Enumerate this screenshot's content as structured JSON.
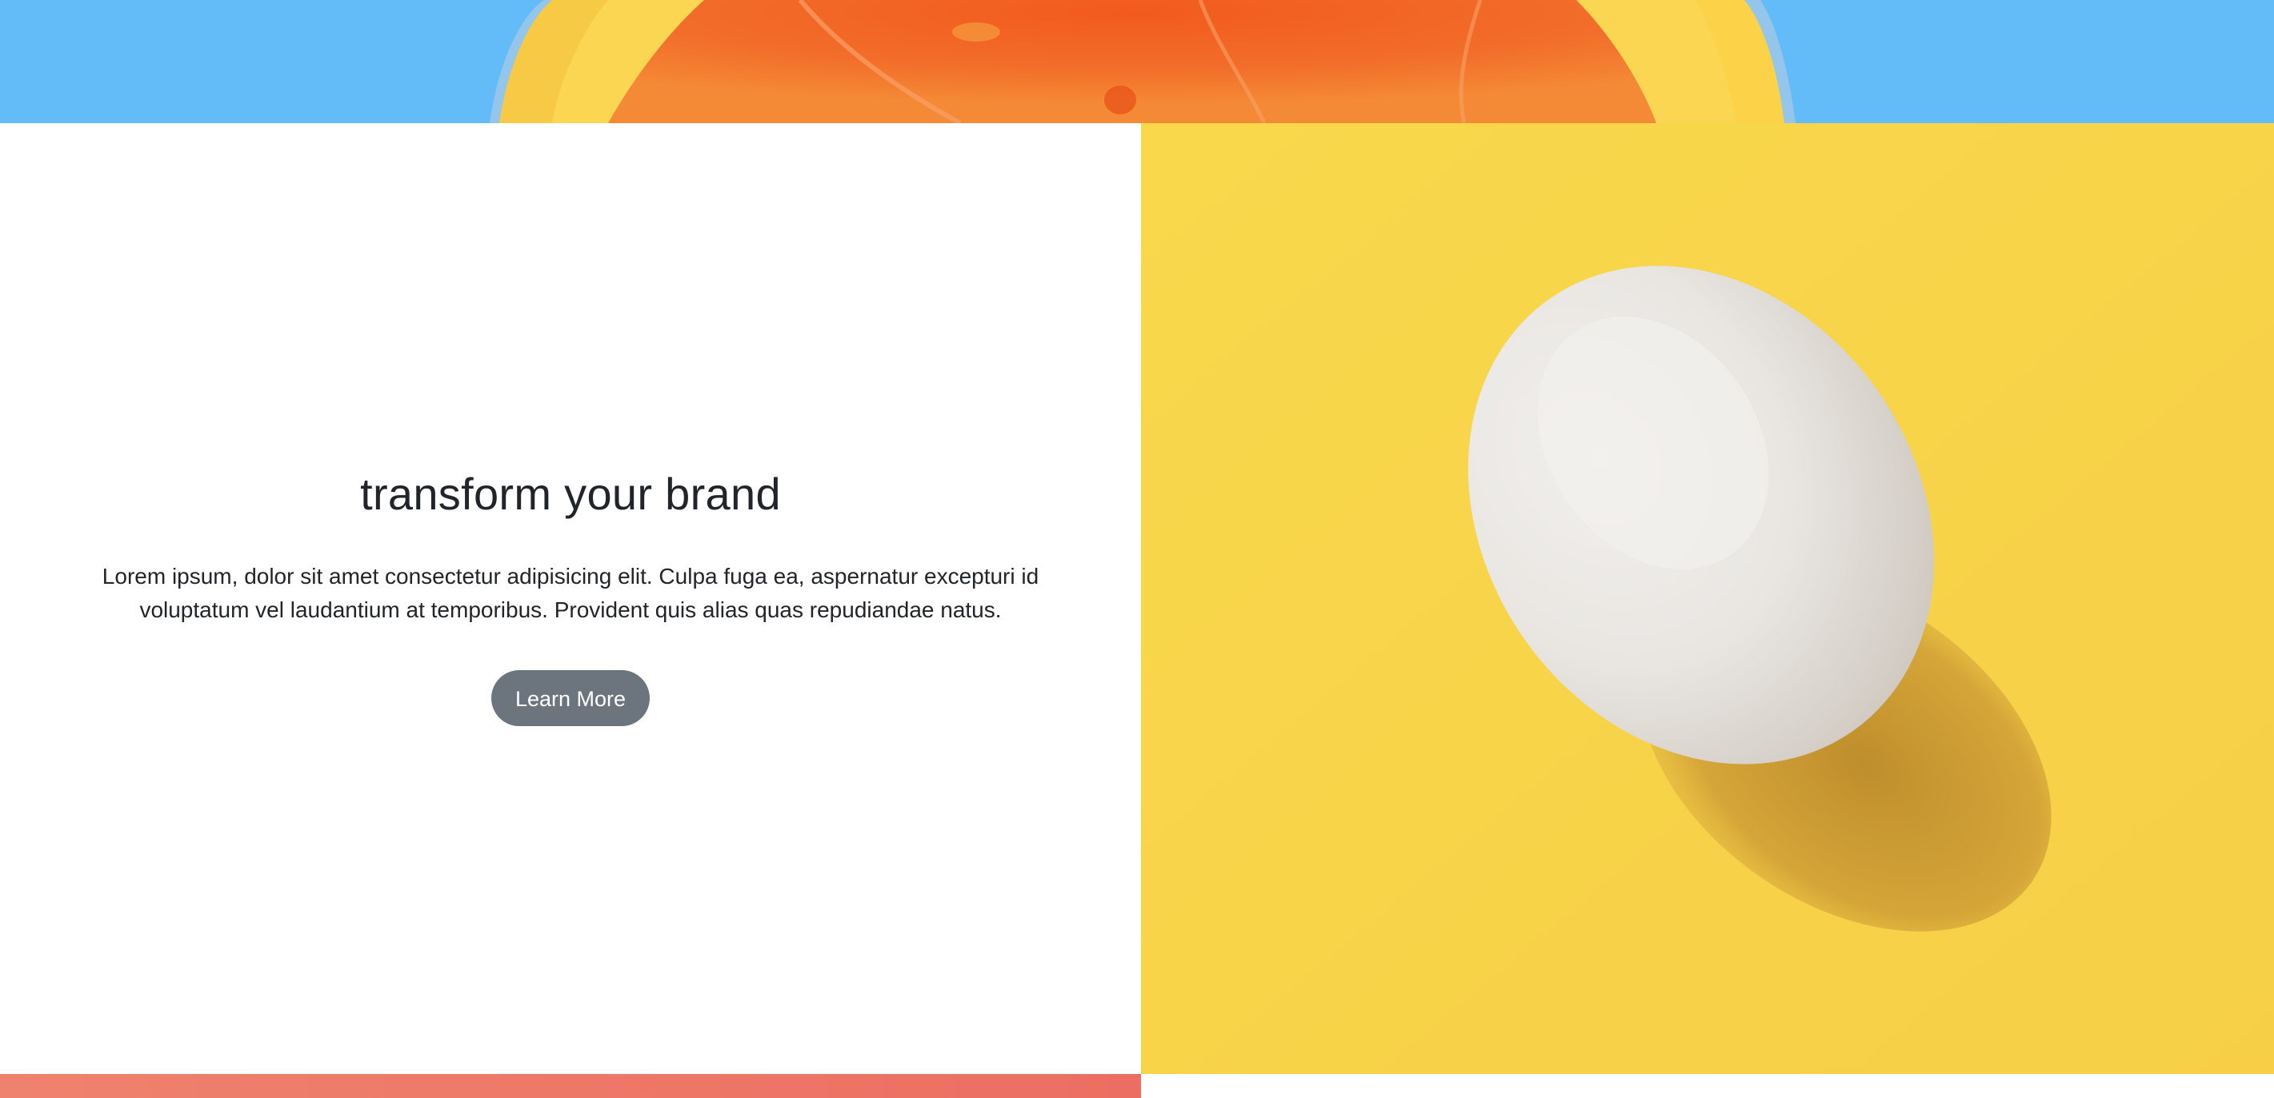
{
  "hero": {
    "headline": "transform your brand",
    "body": "Lorem ipsum, dolor sit amet consectetur adipisicing elit. Culpa fuga ea, aspernatur excepturi id voluptatum vel laudantium at temporibus. Provident quis alias quas repudiandae natus.",
    "button_label": "Learn More"
  },
  "colors": {
    "sky_blue": "#63bcf8",
    "egg_yellow": "#f8d54a",
    "button_gray": "#6c757d",
    "heading_text": "#212529",
    "coral_strip": "#ec6e62"
  },
  "images": {
    "top_banner": "orange-slice-photo",
    "side_panel": "egg-on-yellow-photo"
  }
}
